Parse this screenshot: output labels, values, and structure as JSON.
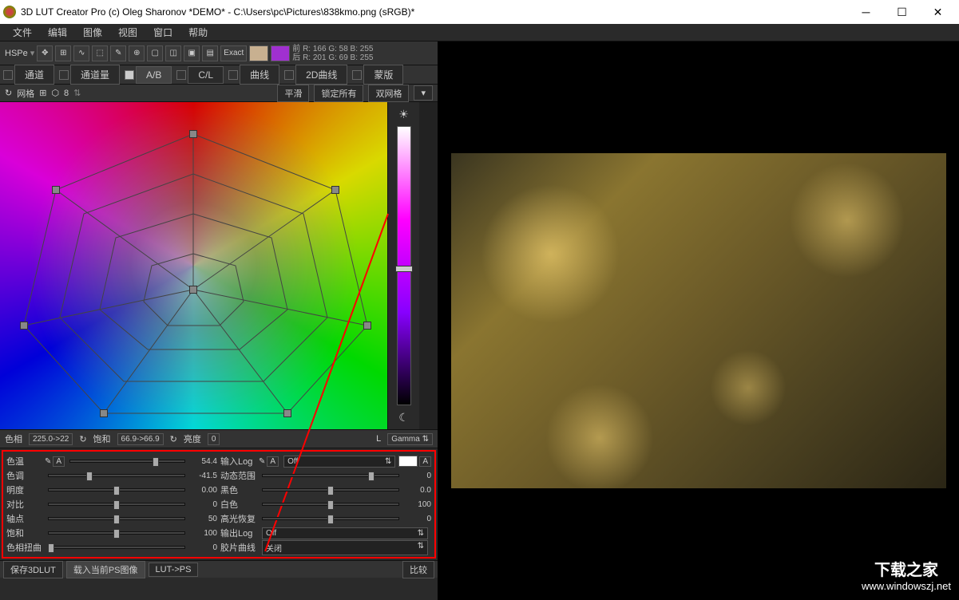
{
  "window": {
    "title": "3D LUT Creator Pro (c) Oleg Sharonov *DEMO* - C:\\Users\\pc\\Pictures\\838kmo.png (sRGB)*"
  },
  "menu": [
    "文件",
    "编辑",
    "图像",
    "视图",
    "窗口",
    "帮助"
  ],
  "toolbar": {
    "hspe": "HSPe",
    "exact": "Exact",
    "swatch1": "#c8b090",
    "swatch2": "#a030d0",
    "before_label": "前",
    "after_label": "后",
    "before": "R: 166  G:  58  B: 255",
    "after": "R: 201  G:  69  B: 255"
  },
  "tabs": [
    "通道",
    "通道量",
    "A/B",
    "C/L",
    "曲线",
    "2D曲线",
    "蒙版"
  ],
  "gridbar": {
    "grid_label": "网格",
    "count": "8",
    "smooth": "平滑",
    "lock": "锁定所有",
    "dual": "双网格"
  },
  "readouts": {
    "hue_label": "色相",
    "hue_val": "225.0->22",
    "sat_label": "饱和",
    "sat_val": "66.9->66.9",
    "lum_label": "亮度",
    "lum_val": "0",
    "l_label": "L",
    "gamma_label": "Gamma"
  },
  "sliders_left": [
    {
      "label": "色温",
      "val": "54.4",
      "pos": 75,
      "a_btn": true
    },
    {
      "label": "色调",
      "val": "-41.5",
      "pos": 30
    },
    {
      "label": "明度",
      "val": "0.00",
      "pos": 50
    },
    {
      "label": "对比",
      "val": "0",
      "pos": 50
    },
    {
      "label": "轴点",
      "val": "50",
      "pos": 50
    },
    {
      "label": "饱和",
      "val": "100",
      "pos": 50
    },
    {
      "label": "色相扭曲",
      "val": "0",
      "pos": 2
    }
  ],
  "sliders_right": [
    {
      "label": "输入Log",
      "dropdown": "Off",
      "a_btn": true,
      "white_sw": true
    },
    {
      "label": "动态范围",
      "val": "0",
      "pos": 80
    },
    {
      "label": "黑色",
      "val": "0.0",
      "pos": 50
    },
    {
      "label": "白色",
      "val": "100",
      "pos": 50
    },
    {
      "label": "高光恢复",
      "val": "0",
      "pos": 50
    },
    {
      "label": "输出Log",
      "dropdown": "Off"
    },
    {
      "label": "胶片曲线",
      "dropdown": "关闭"
    }
  ],
  "bottom": {
    "save3dlut": "保存3DLUT",
    "loadps": "载入当前PS图像",
    "lut2ps": "LUT->PS",
    "compare": "比较"
  },
  "watermark": {
    "line1": "下载之家",
    "line2": "www.windowszj.net"
  }
}
